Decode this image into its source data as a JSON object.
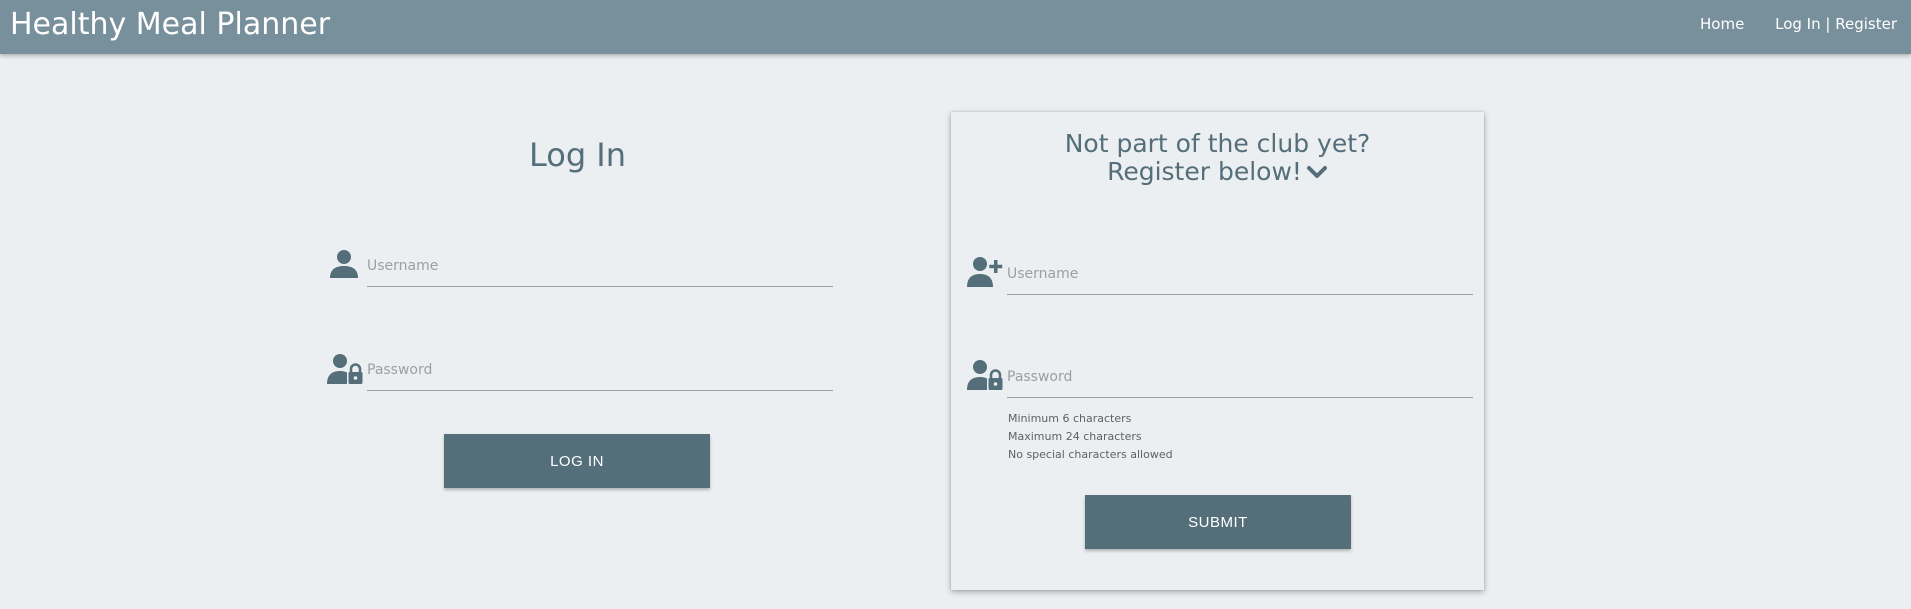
{
  "header": {
    "brand": "Healthy Meal Planner",
    "nav": {
      "home": "Home",
      "login": "Log In",
      "separator": "|",
      "register": "Register"
    }
  },
  "login": {
    "title": "Log In",
    "username_placeholder": "Username",
    "password_placeholder": "Password",
    "submit_label": "LOG IN"
  },
  "register": {
    "title_line1": "Not part of the club yet?",
    "title_line2": "Register below!",
    "username_placeholder": "Username",
    "password_placeholder": "Password",
    "hints": [
      "Minimum 6 characters",
      "Maximum 24 characters",
      "No special characters allowed"
    ],
    "submit_label": "SUBMIT"
  },
  "icons": {
    "user": "person-icon",
    "user_lock": "person-lock-icon",
    "user_add": "person-add-icon",
    "chevron": "chevron-down-icon"
  },
  "colors": {
    "navbar": "#78909c",
    "background": "#eceff1",
    "primary": "#546e7a"
  }
}
